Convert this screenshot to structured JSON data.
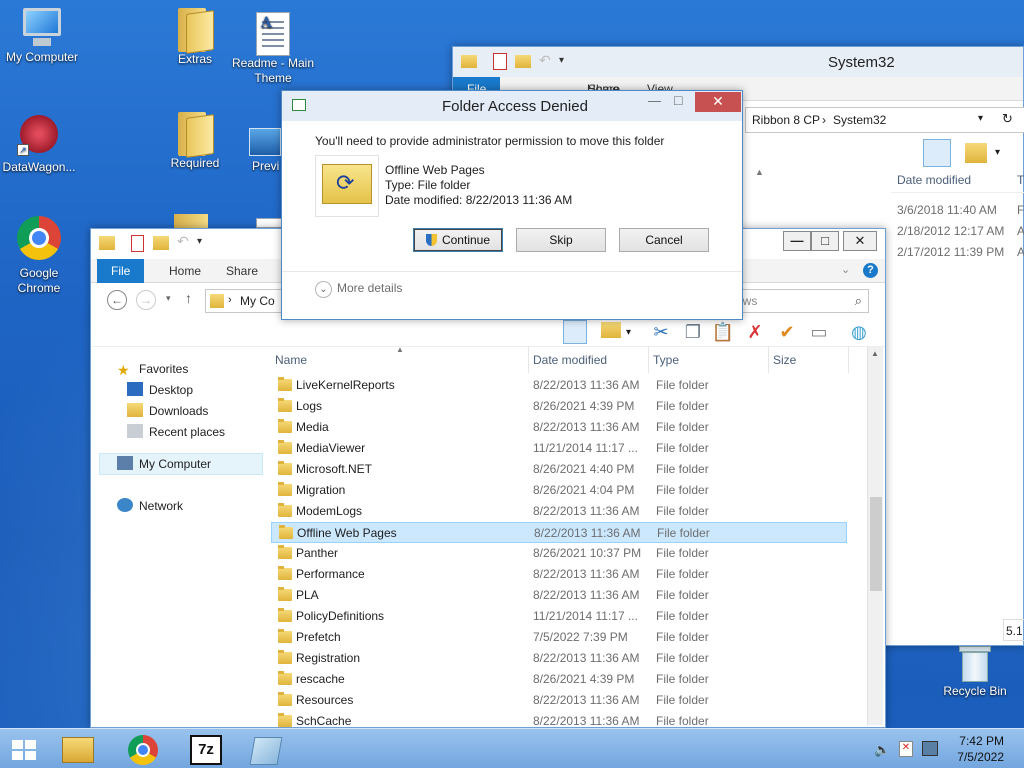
{
  "desktop": {
    "icons": [
      {
        "label": "My Computer"
      },
      {
        "label": "Extras"
      },
      {
        "label": "Readme - Main Theme"
      },
      {
        "label": "DataWagon..."
      },
      {
        "label": "Required"
      },
      {
        "label": "Previ"
      },
      {
        "label": "Google Chrome"
      },
      {
        "label": "Recycle Bin"
      }
    ]
  },
  "bg_window": {
    "title": "System32",
    "tabs": [
      "File",
      "Home",
      "Share",
      "View"
    ],
    "breadcrumb": [
      "Ribbon 8 CP",
      "System32"
    ],
    "columns": [
      "Date modified",
      "T"
    ],
    "rows": [
      {
        "date": "3/6/2018 11:40 AM",
        "type": "F"
      },
      {
        "date": "2/18/2012 12:17 AM",
        "type": "A"
      },
      {
        "date": "2/17/2012 11:39 PM",
        "type": "A"
      }
    ],
    "status": "5.1"
  },
  "explorer": {
    "tabs": [
      "File",
      "Home",
      "Share"
    ],
    "address": "My Co",
    "search_placeholder": "ows",
    "nav": {
      "favorites": "Favorites",
      "desktop": "Desktop",
      "downloads": "Downloads",
      "recent": "Recent places",
      "computer": "My Computer",
      "network": "Network"
    },
    "columns": {
      "name": "Name",
      "date": "Date modified",
      "type": "Type",
      "size": "Size"
    },
    "rows": [
      {
        "name": "LiveKernelReports",
        "date": "8/22/2013 11:36 AM",
        "type": "File folder"
      },
      {
        "name": "Logs",
        "date": "8/26/2021 4:39 PM",
        "type": "File folder"
      },
      {
        "name": "Media",
        "date": "8/22/2013 11:36 AM",
        "type": "File folder"
      },
      {
        "name": "MediaViewer",
        "date": "11/21/2014 11:17 ...",
        "type": "File folder"
      },
      {
        "name": "Microsoft.NET",
        "date": "8/26/2021 4:40 PM",
        "type": "File folder"
      },
      {
        "name": "Migration",
        "date": "8/26/2021 4:04 PM",
        "type": "File folder"
      },
      {
        "name": "ModemLogs",
        "date": "8/22/2013 11:36 AM",
        "type": "File folder"
      },
      {
        "name": "Offline Web Pages",
        "date": "8/22/2013 11:36 AM",
        "type": "File folder"
      },
      {
        "name": "Panther",
        "date": "8/26/2021 10:37 PM",
        "type": "File folder"
      },
      {
        "name": "Performance",
        "date": "8/22/2013 11:36 AM",
        "type": "File folder"
      },
      {
        "name": "PLA",
        "date": "8/22/2013 11:36 AM",
        "type": "File folder"
      },
      {
        "name": "PolicyDefinitions",
        "date": "11/21/2014 11:17 ...",
        "type": "File folder"
      },
      {
        "name": "Prefetch",
        "date": "7/5/2022 7:39 PM",
        "type": "File folder"
      },
      {
        "name": "Registration",
        "date": "8/22/2013 11:36 AM",
        "type": "File folder"
      },
      {
        "name": "rescache",
        "date": "8/26/2021 4:39 PM",
        "type": "File folder"
      },
      {
        "name": "Resources",
        "date": "8/22/2013 11:36 AM",
        "type": "File folder"
      },
      {
        "name": "SchCache",
        "date": "8/22/2013 11:36 AM",
        "type": "File folder"
      }
    ],
    "selected_index": 7
  },
  "dialog": {
    "title": "Folder Access Denied",
    "message": "You'll need to provide administrator permission to move this folder",
    "item_name": "Offline Web Pages",
    "item_type": "Type: File folder",
    "item_date": "Date modified: 8/22/2013 11:36 AM",
    "continue": "Continue",
    "skip": "Skip",
    "cancel": "Cancel",
    "more_details": "More details"
  },
  "taskbar": {
    "time": "7:42 PM",
    "date": "7/5/2022",
    "seven_zip": "7z"
  },
  "colors": {
    "accent": "#1979ca",
    "selection": "#cce8ff",
    "close_red": "#c75050"
  }
}
